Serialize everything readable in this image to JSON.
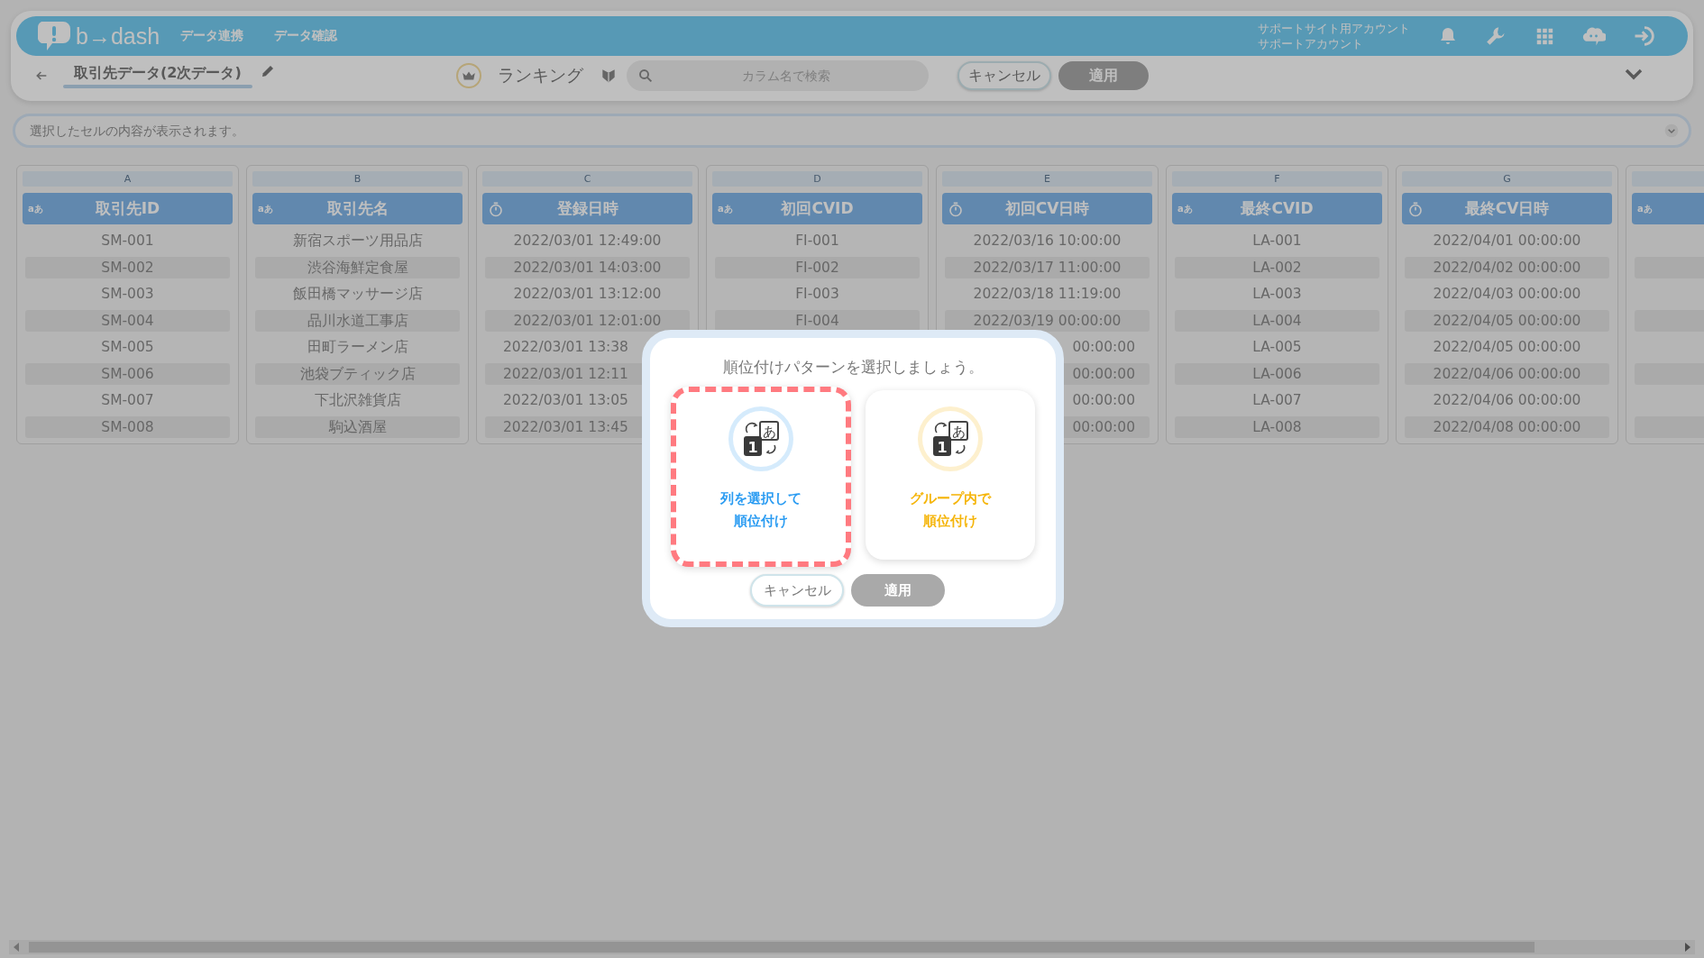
{
  "header": {
    "logo": "b→dash",
    "nav": [
      "データ連携",
      "データ確認"
    ],
    "account": [
      "サポートサイト用アカウント",
      "サポートアカウント"
    ]
  },
  "toolbar": {
    "title": "取引先データ(2次データ)",
    "mode": "ランキング",
    "search": {
      "placeholder": "カラム名で検索"
    },
    "buttons": [
      {
        "label": "キャンセル",
        "disabled": false
      },
      {
        "label": "適用",
        "disabled": true
      }
    ]
  },
  "cell_viewer": {
    "placeholder": "選択したセルの内容が表示されます。"
  },
  "columns": [
    {
      "letter": "A",
      "kind": "text",
      "type_label": "aあ",
      "title": "取引先ID",
      "cells": [
        "SM-001",
        "SM-002",
        "SM-003",
        "SM-004",
        "SM-005",
        "SM-006",
        "SM-007",
        "SM-008"
      ]
    },
    {
      "letter": "B",
      "kind": "text",
      "type_label": "aあ",
      "title": "取引先名",
      "cells": [
        "新宿スポーツ用品店",
        "渋谷海鮮定食屋",
        "飯田橋マッサージ店",
        "品川水道工事店",
        "田町ラーメン店",
        "池袋ブティック店",
        "下北沢雑貨店",
        "駒込酒屋"
      ]
    },
    {
      "letter": "C",
      "kind": "datetime",
      "title": "登録日時",
      "cells": [
        "2022/03/01 12:49:00",
        "2022/03/01 14:03:00",
        "2022/03/01 13:12:00",
        "2022/03/01 12:01:00",
        {
          "text": "2022/03/01 13:38",
          "kind": "cut-right"
        },
        {
          "text": "2022/03/01 12:11",
          "kind": "cut-right"
        },
        {
          "text": "2022/03/01 13:05",
          "kind": "cut-right"
        },
        {
          "text": "2022/03/01 13:45",
          "kind": "cut-right"
        }
      ]
    },
    {
      "letter": "D",
      "kind": "text",
      "type_label": "aあ",
      "title": "初回CVID",
      "cells": [
        "FI-001",
        "FI-002",
        "FI-003",
        "FI-004"
      ]
    },
    {
      "letter": "E",
      "kind": "datetime",
      "title": "初回CV日時",
      "cells": [
        "2022/03/16 10:00:00",
        "2022/03/17 11:00:00",
        "2022/03/18 11:19:00",
        "2022/03/19 00:00:00",
        {
          "text": "00:00:00",
          "kind": "cut-left"
        },
        {
          "text": "00:00:00",
          "kind": "cut-left"
        },
        {
          "text": "00:00:00",
          "kind": "cut-left"
        },
        {
          "text": "00:00:00",
          "kind": "cut-left"
        }
      ]
    },
    {
      "letter": "F",
      "kind": "text",
      "type_label": "aあ",
      "title": "最終CVID",
      "cells": [
        "LA-001",
        "LA-002",
        "LA-003",
        "LA-004",
        "LA-005",
        "LA-006",
        "LA-007",
        "LA-008"
      ]
    },
    {
      "letter": "G",
      "kind": "datetime",
      "title": "最終CV日時",
      "cells": [
        "2022/04/01 00:00:00",
        "2022/04/02 00:00:00",
        "2022/04/03 00:00:00",
        "2022/04/05 00:00:00",
        "2022/04/05 00:00:00",
        "2022/04/06 00:00:00",
        "2022/04/06 00:00:00",
        "2022/04/08 00:00:00"
      ]
    },
    {
      "kind": "text",
      "type_label": "aあ"
    }
  ],
  "dialog": {
    "title": "順位付けパターンを選択しましょう。",
    "options": [
      {
        "label": "列を選択して順位付け",
        "color": "#2b9cf2",
        "selected": true,
        "icon_text": [
          "1",
          "あ"
        ]
      },
      {
        "label": "グループ内で順位付け",
        "color": "#f5b50a",
        "selected": false,
        "icon_text": [
          "1",
          "あ"
        ]
      }
    ],
    "buttons": [
      {
        "label": "キャンセル",
        "disabled": false
      },
      {
        "label": "適用",
        "disabled": true
      }
    ]
  }
}
